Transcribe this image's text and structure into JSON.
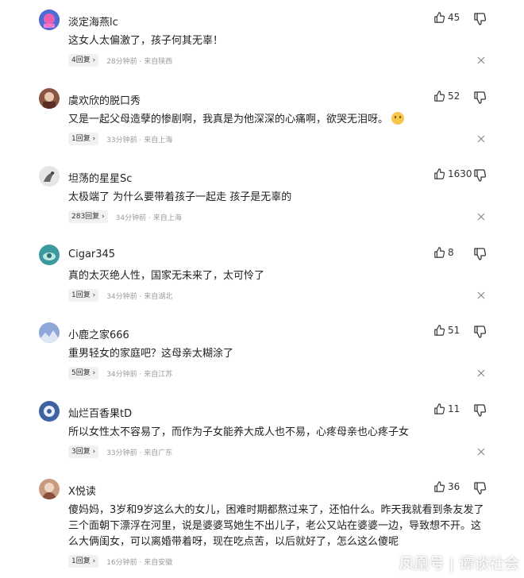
{
  "comments": [
    {
      "username": "淡定海燕lc",
      "likes": "45",
      "text": "这女人太偏激了，孩子何其无辜！",
      "replies": "4回复",
      "time": "28分钟前 · 来自陕西",
      "avatar_color": "#d94fa6"
    },
    {
      "username": "虞欢欣的脱口秀",
      "likes": "52",
      "text": "又是一起父母造孽的惨剧啊，我真是为他深深的心痛啊，欲哭无泪呀。",
      "replies": "1回复",
      "time": "33分钟前 · 来自上海",
      "avatar_color": "#7a4a3a",
      "emoji": "thinking-emoji"
    },
    {
      "username": "坦荡的星星Sc",
      "likes": "1630",
      "text": "太极端了 为什么要带着孩子一起走 孩子是无辜的",
      "replies": "283回复",
      "time": "34分钟前 · 来自上海",
      "avatar_color": "#b9b9b9"
    },
    {
      "username": "Cigar345",
      "likes": "8",
      "text": "真的太灭绝人性，国家无未来了，太可怜了",
      "replies": "1回复",
      "time": "34分钟前 · 来自湖北",
      "avatar_color": "#3a9aa0"
    },
    {
      "username": "小鹿之家666",
      "likes": "51",
      "text": "重男轻女的家庭吧？这母亲太糊涂了",
      "replies": "5回复",
      "time": "34分钟前 · 来自江苏",
      "avatar_color": "#6d86c4"
    },
    {
      "username": "灿烂百香果tD",
      "likes": "11",
      "text": "所以女性太不容易了，而作为子女能养大成人也不易，心疼母亲也心疼子女",
      "replies": "3回复",
      "time": "33分钟前 · 来自广东",
      "avatar_color": "#5a7bb0"
    },
    {
      "username": "X悦读",
      "likes": "36",
      "text": "傻妈妈，3岁和9岁这么大的女儿，困难时期都熬过来了，还怕什么。昨天我就看到条友发了三个面朝下漂浮在河里，说是婆婆骂她生不出儿子，老公又站在婆婆一边，导致想不开。这么大俩闺女，可以离婚带着呀，现在吃点苦，以后就好了，怎么这么傻呢",
      "replies": "1回复",
      "time": "16分钟前 · 来自安徽",
      "avatar_color": "#b07a5a"
    }
  ],
  "watermark": {
    "left": "凤凰号",
    "right": "谭谈社会"
  }
}
